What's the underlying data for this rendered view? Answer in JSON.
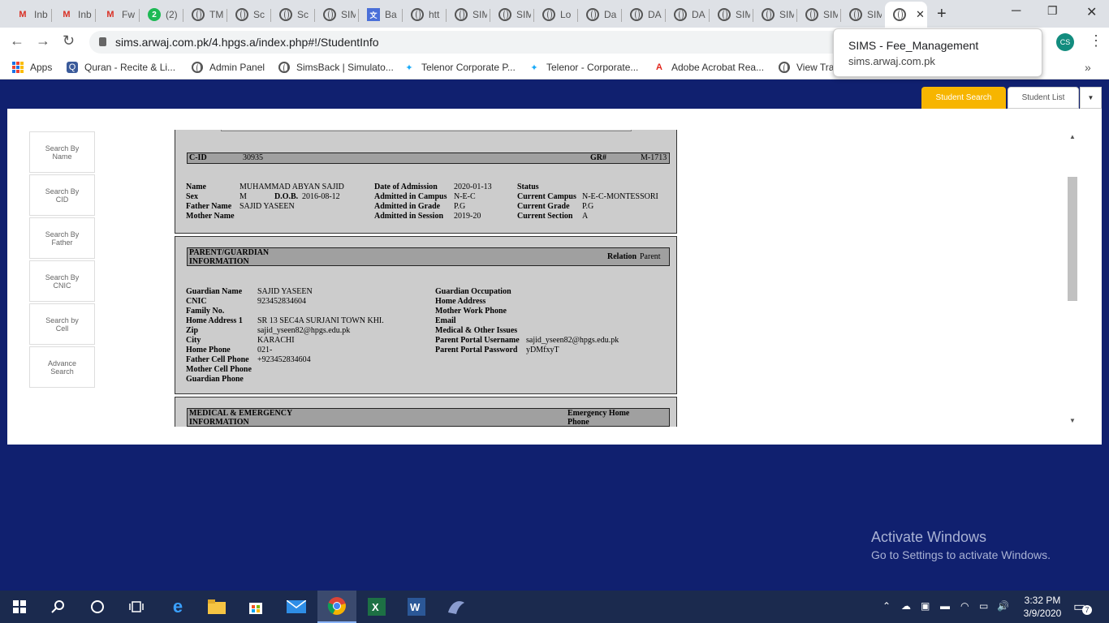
{
  "browser": {
    "tabs": [
      {
        "icon": "gmail-icon",
        "title": "Inb"
      },
      {
        "icon": "gmail-icon",
        "title": "Inb"
      },
      {
        "icon": "gmail-icon",
        "title": "Fw"
      },
      {
        "icon": "notification-icon",
        "badge": "2",
        "title": "(2)"
      },
      {
        "icon": "globe-icon",
        "title": "TM"
      },
      {
        "icon": "globe-icon",
        "title": "Sc"
      },
      {
        "icon": "globe-icon",
        "title": "Sc"
      },
      {
        "icon": "globe-icon",
        "title": "SIM"
      },
      {
        "icon": "translate-icon",
        "title": "Ba"
      },
      {
        "icon": "globe-icon",
        "title": "htt"
      },
      {
        "icon": "globe-icon",
        "title": "SIM"
      },
      {
        "icon": "globe-icon",
        "title": "SIM"
      },
      {
        "icon": "globe-icon",
        "title": "Lo"
      },
      {
        "icon": "globe-icon",
        "title": "Da"
      },
      {
        "icon": "globe-icon",
        "title": "DA"
      },
      {
        "icon": "globe-icon",
        "title": "DA"
      },
      {
        "icon": "globe-icon",
        "title": "SIM"
      },
      {
        "icon": "globe-icon",
        "title": "SIM"
      },
      {
        "icon": "globe-icon",
        "title": "SIM"
      },
      {
        "icon": "globe-icon",
        "title": "SIM"
      },
      {
        "icon": "globe-icon",
        "title": "",
        "active": true,
        "close": "✕"
      }
    ],
    "new_tab": "+",
    "url": "sims.arwaj.com.pk/4.hpgs.a/index.php#!/StudentInfo",
    "profile_initials": "CS",
    "hover_card": {
      "title": "SIMS - Fee_Management",
      "url": "sims.arwaj.com.pk"
    },
    "bookmarks": [
      {
        "icon": "apps-icon",
        "label": "Apps"
      },
      {
        "icon": "quran-icon",
        "label": "Quran - Recite & Li..."
      },
      {
        "icon": "globe-icon",
        "label": "Admin Panel"
      },
      {
        "icon": "globe-icon",
        "label": "SimsBack | Simulato..."
      },
      {
        "icon": "telenor-icon",
        "label": "Telenor Corporate P..."
      },
      {
        "icon": "telenor-icon",
        "label": "Telenor - Corporate..."
      },
      {
        "icon": "adobe-icon",
        "label": "Adobe Acrobat Rea..."
      },
      {
        "icon": "globe-icon",
        "label": "View Tra"
      }
    ],
    "bookmarks_more": "»"
  },
  "page": {
    "top_buttons": {
      "student_search": "Student Search",
      "student_list": "Student List"
    },
    "sidebar": [
      {
        "label1": "Search By",
        "label2": "Name"
      },
      {
        "label1": "Search By",
        "label2": "CID"
      },
      {
        "label1": "Search By",
        "label2": "Father"
      },
      {
        "label1": "Search By",
        "label2": "CNIC"
      },
      {
        "label1": "Search by",
        "label2": "Cell"
      },
      {
        "label1": "Advance",
        "label2": "Search"
      }
    ],
    "student": {
      "cid_label": "C-ID",
      "cid": "30935",
      "gr_label": "GR#",
      "gr": "M-1713",
      "name_label": "Name",
      "name": "MUHAMMAD ABYAN SAJID",
      "sex_label": "Sex",
      "sex": "M",
      "dob_label": "D.O.B.",
      "dob": "2016-08-12",
      "father_label": "Father Name",
      "father": "SAJID YASEEN",
      "mother_label": "Mother Name",
      "doa_label": "Date of Admission",
      "doa": "2020-01-13",
      "aic_label": "Admitted in Campus",
      "aic": "N-E-C",
      "aig_label": "Admitted in Grade",
      "aig": "P.G",
      "ais_label": "Admitted in Session",
      "ais": "2019-20",
      "status_label": "Status",
      "cc_label": "Current Campus",
      "cc": "N-E-C-MONTESSORI",
      "cg_label": "Current Grade",
      "cg": "P.G",
      "cs_label": "Current Section",
      "cs": "A"
    },
    "guardian": {
      "header1": "PARENT/GUARDIAN",
      "header2": "INFORMATION",
      "relation_label": "Relation",
      "relation": "Parent",
      "left": [
        {
          "label": "Guardian Name",
          "value": "SAJID YASEEN"
        },
        {
          "label": "CNIC",
          "value": "923452834604"
        },
        {
          "label": "Family No.",
          "value": ""
        },
        {
          "label": "Home Address 1",
          "value": "SR 13 SEC4A SURJANI TOWN KHI."
        },
        {
          "label": "Zip",
          "value": "sajid_yseen82@hpgs.edu.pk"
        },
        {
          "label": "City",
          "value": "KARACHI"
        },
        {
          "label": "Home Phone",
          "value": "021-"
        },
        {
          "label": "Father Cell Phone",
          "value": "+923452834604"
        },
        {
          "label": "Mother Cell Phone",
          "value": ""
        },
        {
          "label": "Guardian Phone",
          "value": ""
        }
      ],
      "right": [
        {
          "label": "Guardian Occupation",
          "value": ""
        },
        {
          "label": "Home Address",
          "value": ""
        },
        {
          "label": "Mother Work Phone",
          "value": ""
        },
        {
          "label": "Email",
          "value": ""
        },
        {
          "label": "Medical & Other Issues",
          "value": ""
        },
        {
          "label": "Parent Portal Username",
          "value": "sajid_yseen82@hpgs.edu.pk"
        },
        {
          "label": "Parent Portal Password",
          "value": "yDMfxyT"
        }
      ]
    },
    "medical": {
      "header1": "MEDICAL & EMERGENCY",
      "header2": "INFORMATION",
      "right1": "Emergency Home",
      "right2": "Phone"
    }
  },
  "watermark": {
    "line1": "Activate Windows",
    "line2": "Go to Settings to activate Windows."
  },
  "taskbar": {
    "time": "3:32 PM",
    "date": "3/9/2020",
    "notifications_count": "7",
    "apps": [
      "windows-start-icon",
      "search-icon",
      "cortana-icon",
      "task-view-icon",
      "edge-icon",
      "file-explorer-icon",
      "store-icon",
      "mail-icon",
      "chrome-icon",
      "excel-icon",
      "word-icon",
      "app-icon"
    ]
  }
}
